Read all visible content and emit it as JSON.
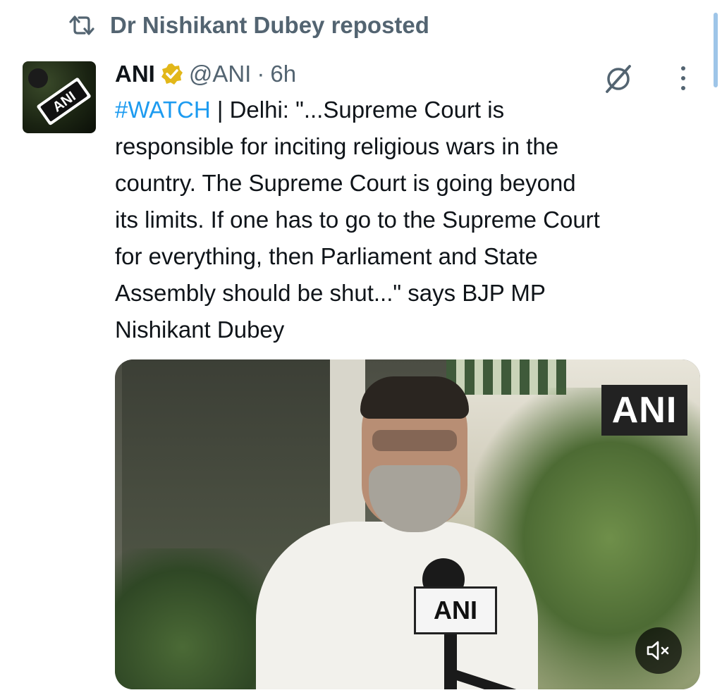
{
  "repost": {
    "label": "Dr Nishikant Dubey reposted",
    "icon": "repost-icon"
  },
  "tweet": {
    "author_name": "ANI",
    "handle": "@ANI",
    "separator": "·",
    "time": "6h",
    "verified_color": "#e2b719",
    "hashtag": "#WATCH",
    "text": " | Delhi: \"...Supreme Court is\nresponsible for inciting religious wars in the\ncountry. The Supreme Court is going beyond\nits limits. If one has to go to the Supreme Court\nfor everything, then Parliament and State\nAssembly should be shut...\" says BJP MP\nNishikant Dubey",
    "hashtag_color": "#1d9bf0"
  },
  "avatar": {
    "text": "ANI"
  },
  "media": {
    "watermark": "ANI",
    "mic_label": "ANI",
    "mute_icon": "speaker-muted-icon"
  },
  "icons": {
    "grok": "grok-icon",
    "more": "more-vertical-icon"
  }
}
